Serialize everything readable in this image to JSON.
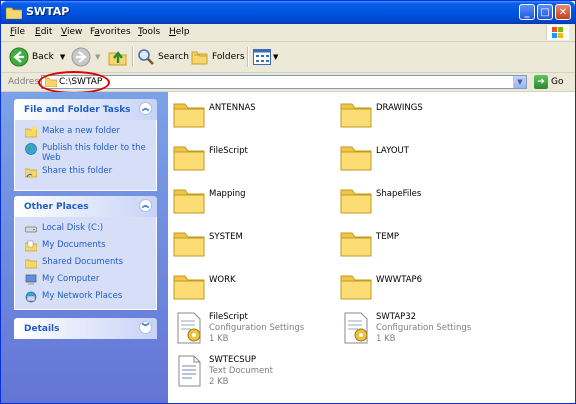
{
  "window": {
    "title": "SWTAP"
  },
  "menu": [
    "File",
    "Edit",
    "View",
    "Favorites",
    "Tools",
    "Help"
  ],
  "menu_underline": [
    "F",
    "E",
    "V",
    "a",
    "T",
    "H"
  ],
  "toolbar": {
    "back": "Back",
    "search": "Search",
    "folders": "Folders"
  },
  "address": {
    "label": "Address",
    "value": "C:\\SWTAP",
    "go": "Go"
  },
  "panels": {
    "file_tasks": {
      "title": "File and Folder Tasks",
      "links": [
        "Make a new folder",
        "Publish this folder to the Web",
        "Share this folder"
      ]
    },
    "other_places": {
      "title": "Other Places",
      "links": [
        "Local Disk (C:)",
        "My Documents",
        "Shared Documents",
        "My Computer",
        "My Network Places"
      ]
    },
    "details": {
      "title": "Details"
    }
  },
  "items": [
    {
      "name": "ANTENNAS",
      "kind": "folder"
    },
    {
      "name": "DRAWINGS",
      "kind": "folder"
    },
    {
      "name": "FileScript",
      "kind": "folder"
    },
    {
      "name": "LAYOUT",
      "kind": "folder"
    },
    {
      "name": "Mapping",
      "kind": "folder"
    },
    {
      "name": "ShapeFiles",
      "kind": "folder"
    },
    {
      "name": "SYSTEM",
      "kind": "folder"
    },
    {
      "name": "TEMP",
      "kind": "folder"
    },
    {
      "name": "WORK",
      "kind": "folder"
    },
    {
      "name": "WWWTAP6",
      "kind": "folder"
    },
    {
      "name": "FileScript",
      "kind": "config",
      "type": "Configuration Settings",
      "size": "1 KB"
    },
    {
      "name": "SWTAP32",
      "kind": "config",
      "type": "Configuration Settings",
      "size": "1 KB"
    },
    {
      "name": "SWTECSUP",
      "kind": "text",
      "type": "Text Document",
      "size": "2 KB"
    }
  ],
  "colors": {
    "title_bar": "#0054e3",
    "link": "#215dc6",
    "taskpane": "#6f8ede",
    "annotation": "#e00000"
  }
}
